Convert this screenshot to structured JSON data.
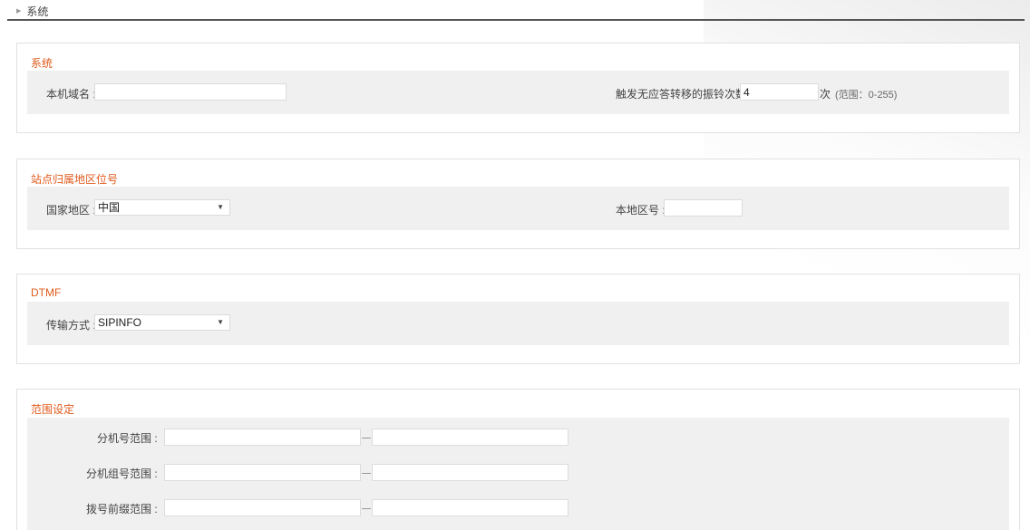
{
  "breadcrumb": {
    "label": "系统"
  },
  "sections": {
    "system": {
      "title": "系统",
      "hostname_label": "本机域名 :",
      "hostname_value": "",
      "ring_label": "触发无应答转移的振铃次数 :",
      "ring_value": "4",
      "ring_unit": "次",
      "ring_hint": "(范围：0-255)"
    },
    "site": {
      "title": "站点归属地区位号",
      "country_label": "国家地区 :",
      "country_value": "中国",
      "area_label": "本地区号 :",
      "area_value": ""
    },
    "dtmf": {
      "title": "DTMF",
      "mode_label": "传输方式 :",
      "mode_value": "SIPINFO"
    },
    "range": {
      "title": "范围设定",
      "ext_label": "分机号范围 :",
      "group_label": "分机组号范围 :",
      "prefix_label": "拨号前缀范围 :",
      "ext_from": "",
      "ext_to": "",
      "group_from": "",
      "group_to": "",
      "prefix_from": "",
      "prefix_to": ""
    }
  }
}
